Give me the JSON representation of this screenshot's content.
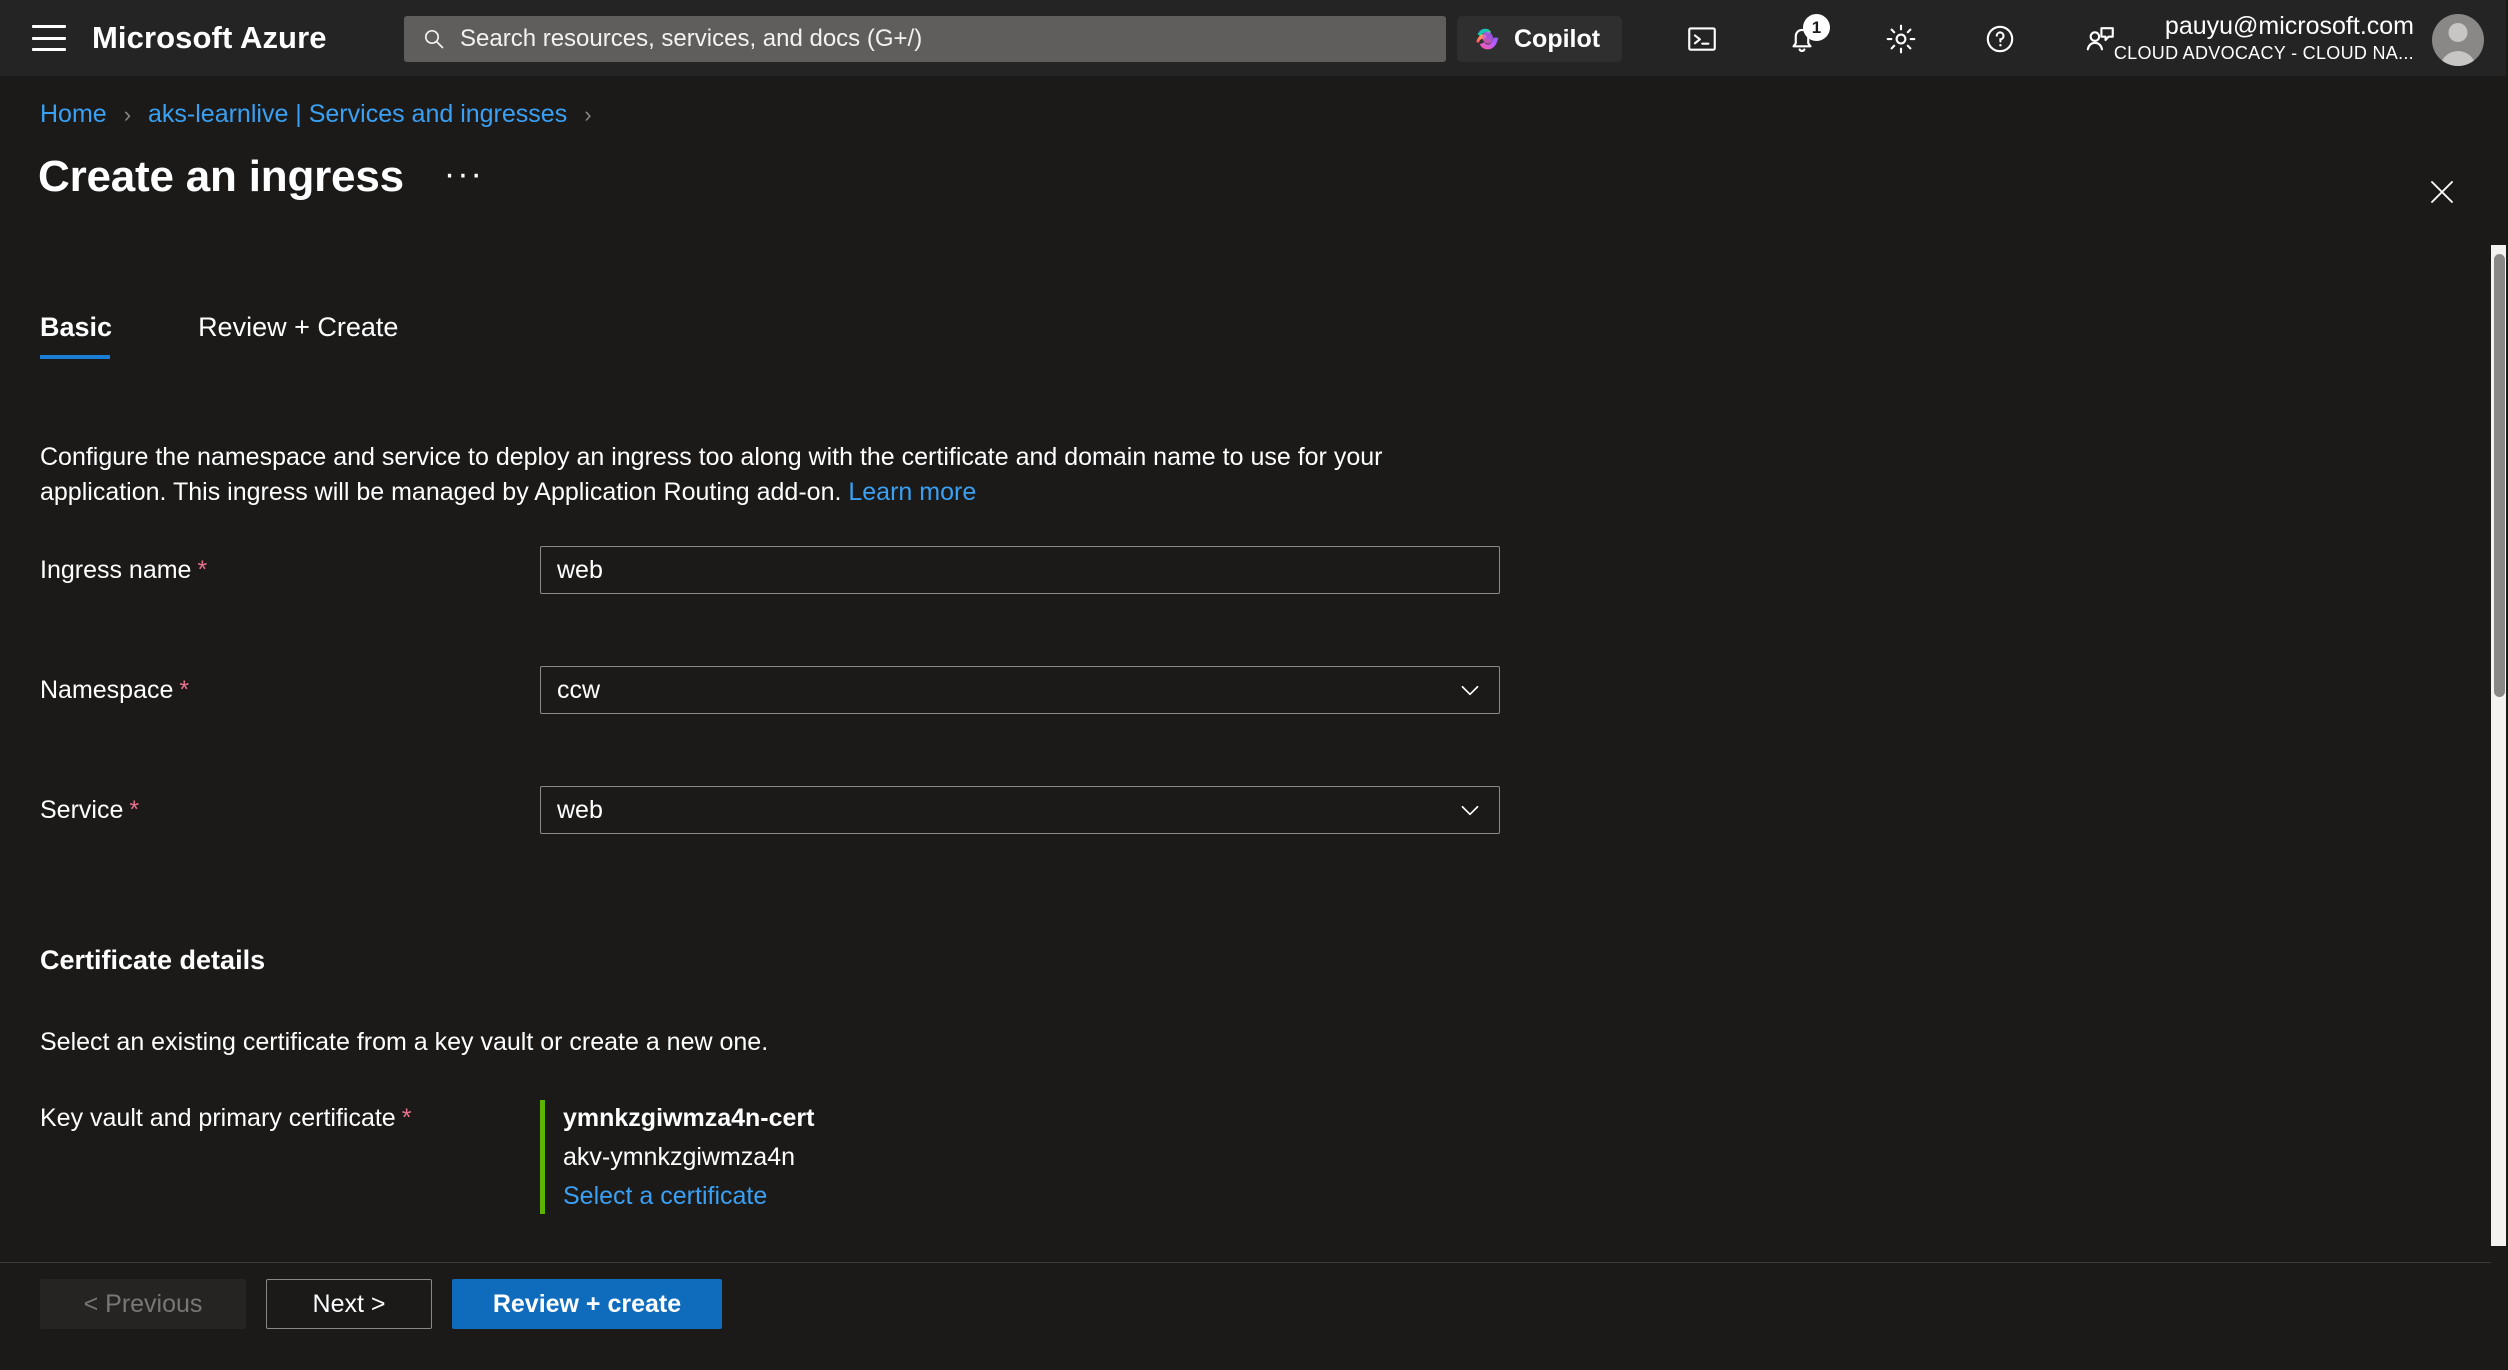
{
  "topbar": {
    "menu_icon": "hamburger-icon",
    "brand": "Microsoft Azure",
    "search": {
      "placeholder": "Search resources, services, and docs (G+/)",
      "icon": "search-icon"
    },
    "copilot": {
      "label": "Copilot",
      "icon": "copilot-icon"
    },
    "icons": [
      {
        "name": "cloud-shell-icon",
        "label": "Cloud Shell"
      },
      {
        "name": "notifications-icon",
        "label": "Notifications",
        "badge": "1"
      },
      {
        "name": "settings-gear-icon",
        "label": "Settings"
      },
      {
        "name": "help-question-icon",
        "label": "Help"
      },
      {
        "name": "feedback-icon",
        "label": "Feedback"
      }
    ],
    "account": {
      "email": "pauyu@microsoft.com",
      "org": "CLOUD ADVOCACY - CLOUD NA..."
    }
  },
  "breadcrumb": {
    "items": [
      {
        "label": "Home"
      },
      {
        "label": "aks-learnlive | Services and ingresses"
      }
    ],
    "separator": "›"
  },
  "header": {
    "title": "Create an ingress",
    "more_label": "···",
    "close_icon": "close-icon"
  },
  "tabs": [
    {
      "label": "Basic",
      "active": true
    },
    {
      "label": "Review + Create",
      "active": false
    }
  ],
  "description": {
    "text": "Configure the namespace and service to deploy an ingress too along with the certificate and domain name to use for your application. This ingress will be managed by Application Routing add-on.",
    "link": "Learn more"
  },
  "form": {
    "fields": [
      {
        "label": "Ingress name",
        "required": "*",
        "value": "web",
        "type": "text"
      },
      {
        "label": "Namespace",
        "required": "*",
        "value": "ccw",
        "type": "select"
      },
      {
        "label": "Service",
        "required": "*",
        "value": "web",
        "type": "select"
      }
    ]
  },
  "certificate": {
    "heading": "Certificate details",
    "subtext": "Select an existing certificate from a key vault or create a new one.",
    "label": "Key vault and primary certificate",
    "required": "*",
    "cert_name": "ymnkzgiwmza4n-cert",
    "vault_name": "akv-ymnkzgiwmza4n",
    "select_link": "Select a certificate",
    "accent_color": "#5cb300"
  },
  "footer": {
    "previous": "< Previous",
    "next": "Next >",
    "review_create": "Review + create"
  },
  "colors": {
    "background": "#1b1a19",
    "topbar": "#242424",
    "link": "#3aa0f3",
    "primary_button": "#0f6cbd",
    "tab_underline": "#1a7fd4",
    "required_star": "#e8718d",
    "cert_accent": "#5cb300"
  }
}
